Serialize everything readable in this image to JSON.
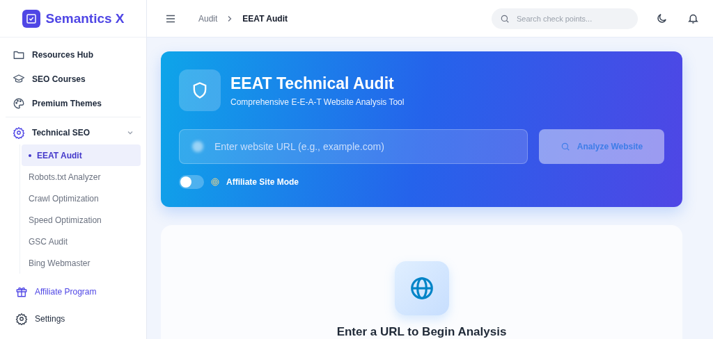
{
  "brand": {
    "name": "Semantics X"
  },
  "sidebar": {
    "items": [
      {
        "label": "Resources Hub",
        "kind": "folder"
      },
      {
        "label": "SEO Courses",
        "kind": "cap"
      },
      {
        "label": "Premium Themes",
        "kind": "palette"
      }
    ],
    "group": {
      "label": "Technical SEO",
      "expanded": true,
      "children": [
        {
          "label": "EEAT Audit",
          "selected": true
        },
        {
          "label": "Robots.txt Analyzer",
          "selected": false
        },
        {
          "label": "Crawl Optimization",
          "selected": false
        },
        {
          "label": "Speed Optimization",
          "selected": false
        },
        {
          "label": "GSC Audit",
          "selected": false
        },
        {
          "label": "Bing Webmaster",
          "selected": false
        }
      ]
    },
    "footer": [
      {
        "label": "Affiliate Program",
        "kind": "gift",
        "highlight": true
      },
      {
        "label": "Settings",
        "kind": "gear",
        "highlight": false
      }
    ]
  },
  "header": {
    "breadcrumb": [
      "Audit",
      "EEAT Audit"
    ],
    "search": {
      "placeholder": "Search check points..."
    }
  },
  "hero": {
    "title": "EEAT Technical Audit",
    "subtitle": "Comprehensive E-E-A-T Website Analysis Tool",
    "url_field": {
      "placeholder": "Enter website URL (e.g., example.com)"
    },
    "button": {
      "label": "Analyze Website",
      "disabled": true
    },
    "toggle": {
      "label": "Affiliate Site Mode",
      "on": false
    }
  },
  "empty_state": {
    "title": "Enter a URL to Begin Analysis"
  }
}
